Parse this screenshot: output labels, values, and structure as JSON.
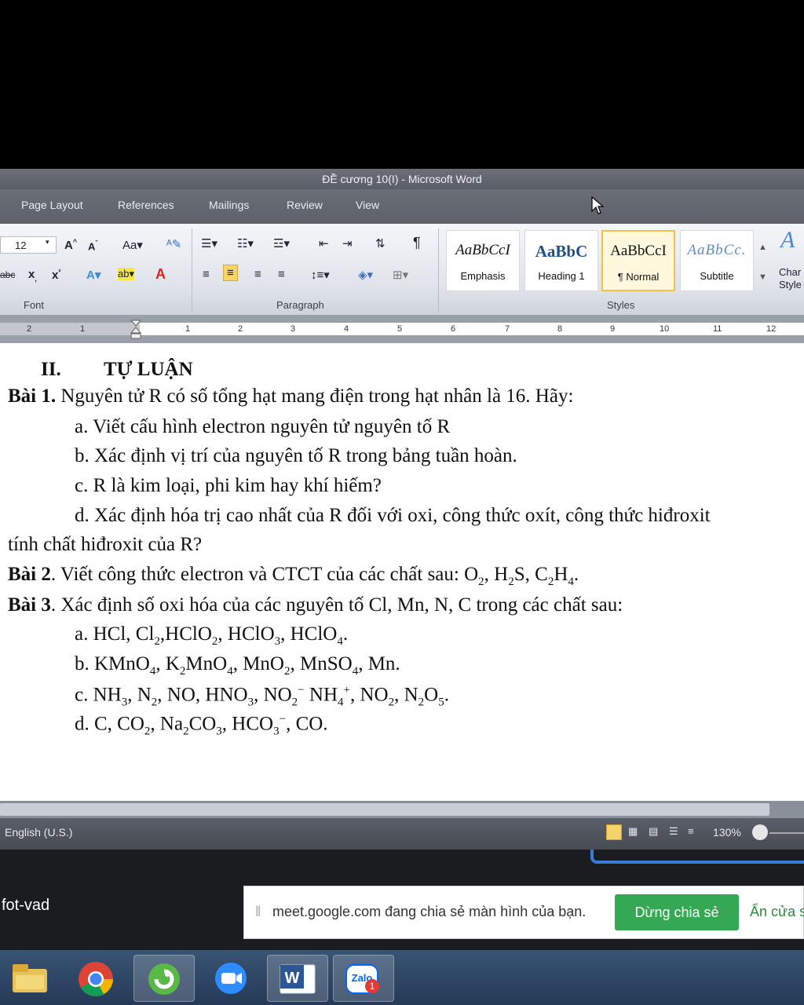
{
  "window": {
    "title": "ĐỀ cương 10(I) - Microsoft Word"
  },
  "ribbon": {
    "tabs": [
      "Page Layout",
      "References",
      "Mailings",
      "Review",
      "View"
    ],
    "font_size": "12",
    "groups": {
      "font": "Font",
      "paragraph": "Paragraph",
      "styles": "Styles"
    },
    "styles": [
      {
        "sample": "AaBbCcI",
        "name": "Emphasis"
      },
      {
        "sample": "AaBbC",
        "name": "Heading 1"
      },
      {
        "sample": "AaBbCcI",
        "name": "¶ Normal"
      },
      {
        "sample": "AaBbCc.",
        "name": "Subtitle"
      }
    ],
    "change_styles": "Change Styles",
    "change_styles_short": [
      "Char",
      "Style"
    ]
  },
  "ruler": {
    "numbers": [
      "2",
      "1",
      "1",
      "2",
      "3",
      "4",
      "5",
      "6",
      "7",
      "8",
      "9",
      "10",
      "11",
      "12"
    ]
  },
  "document": {
    "heading_num": "II.",
    "heading": "TỰ LUẬN",
    "b1_label": "Bài 1.",
    "b1_text": " Nguyên tử R có số tổng hạt mang điện trong hạt nhân là 16. Hãy:",
    "b1_a": "a. Viết cấu hình electron nguyên tử nguyên tố R",
    "b1_b": "b. Xác định vị trí của nguyên tố R trong bảng tuần hoàn.",
    "b1_c": "c. R là kim loại, phi kim hay khí hiếm?",
    "b1_d": "d. Xác định hóa trị cao nhất của R đối với oxi, công thức oxít, công thức hiđroxit",
    "b1_d2": "tính chất hiđroxit của R?",
    "b2_label": "Bài 2",
    "b2_text": ". Viết công thức electron và CTCT của các chất sau: ",
    "b3_label": "Bài 3",
    "b3_text": ". Xác định số oxi hóa của các nguyên tố Cl, Mn, N, C trong các chất sau:"
  },
  "status": {
    "language": "English (U.S.)",
    "zoom": "130%"
  },
  "share": {
    "user": "fot-vad",
    "message": "meet.google.com đang chia sẻ màn hình của bạn.",
    "stop": "Dừng chia sẻ",
    "hide": "Ẩn cửa sổ"
  },
  "taskbar": {
    "apps": [
      "file-explorer",
      "chrome",
      "app-green",
      "zoom",
      "word",
      "zalo"
    ],
    "zalo_badge": "1"
  }
}
